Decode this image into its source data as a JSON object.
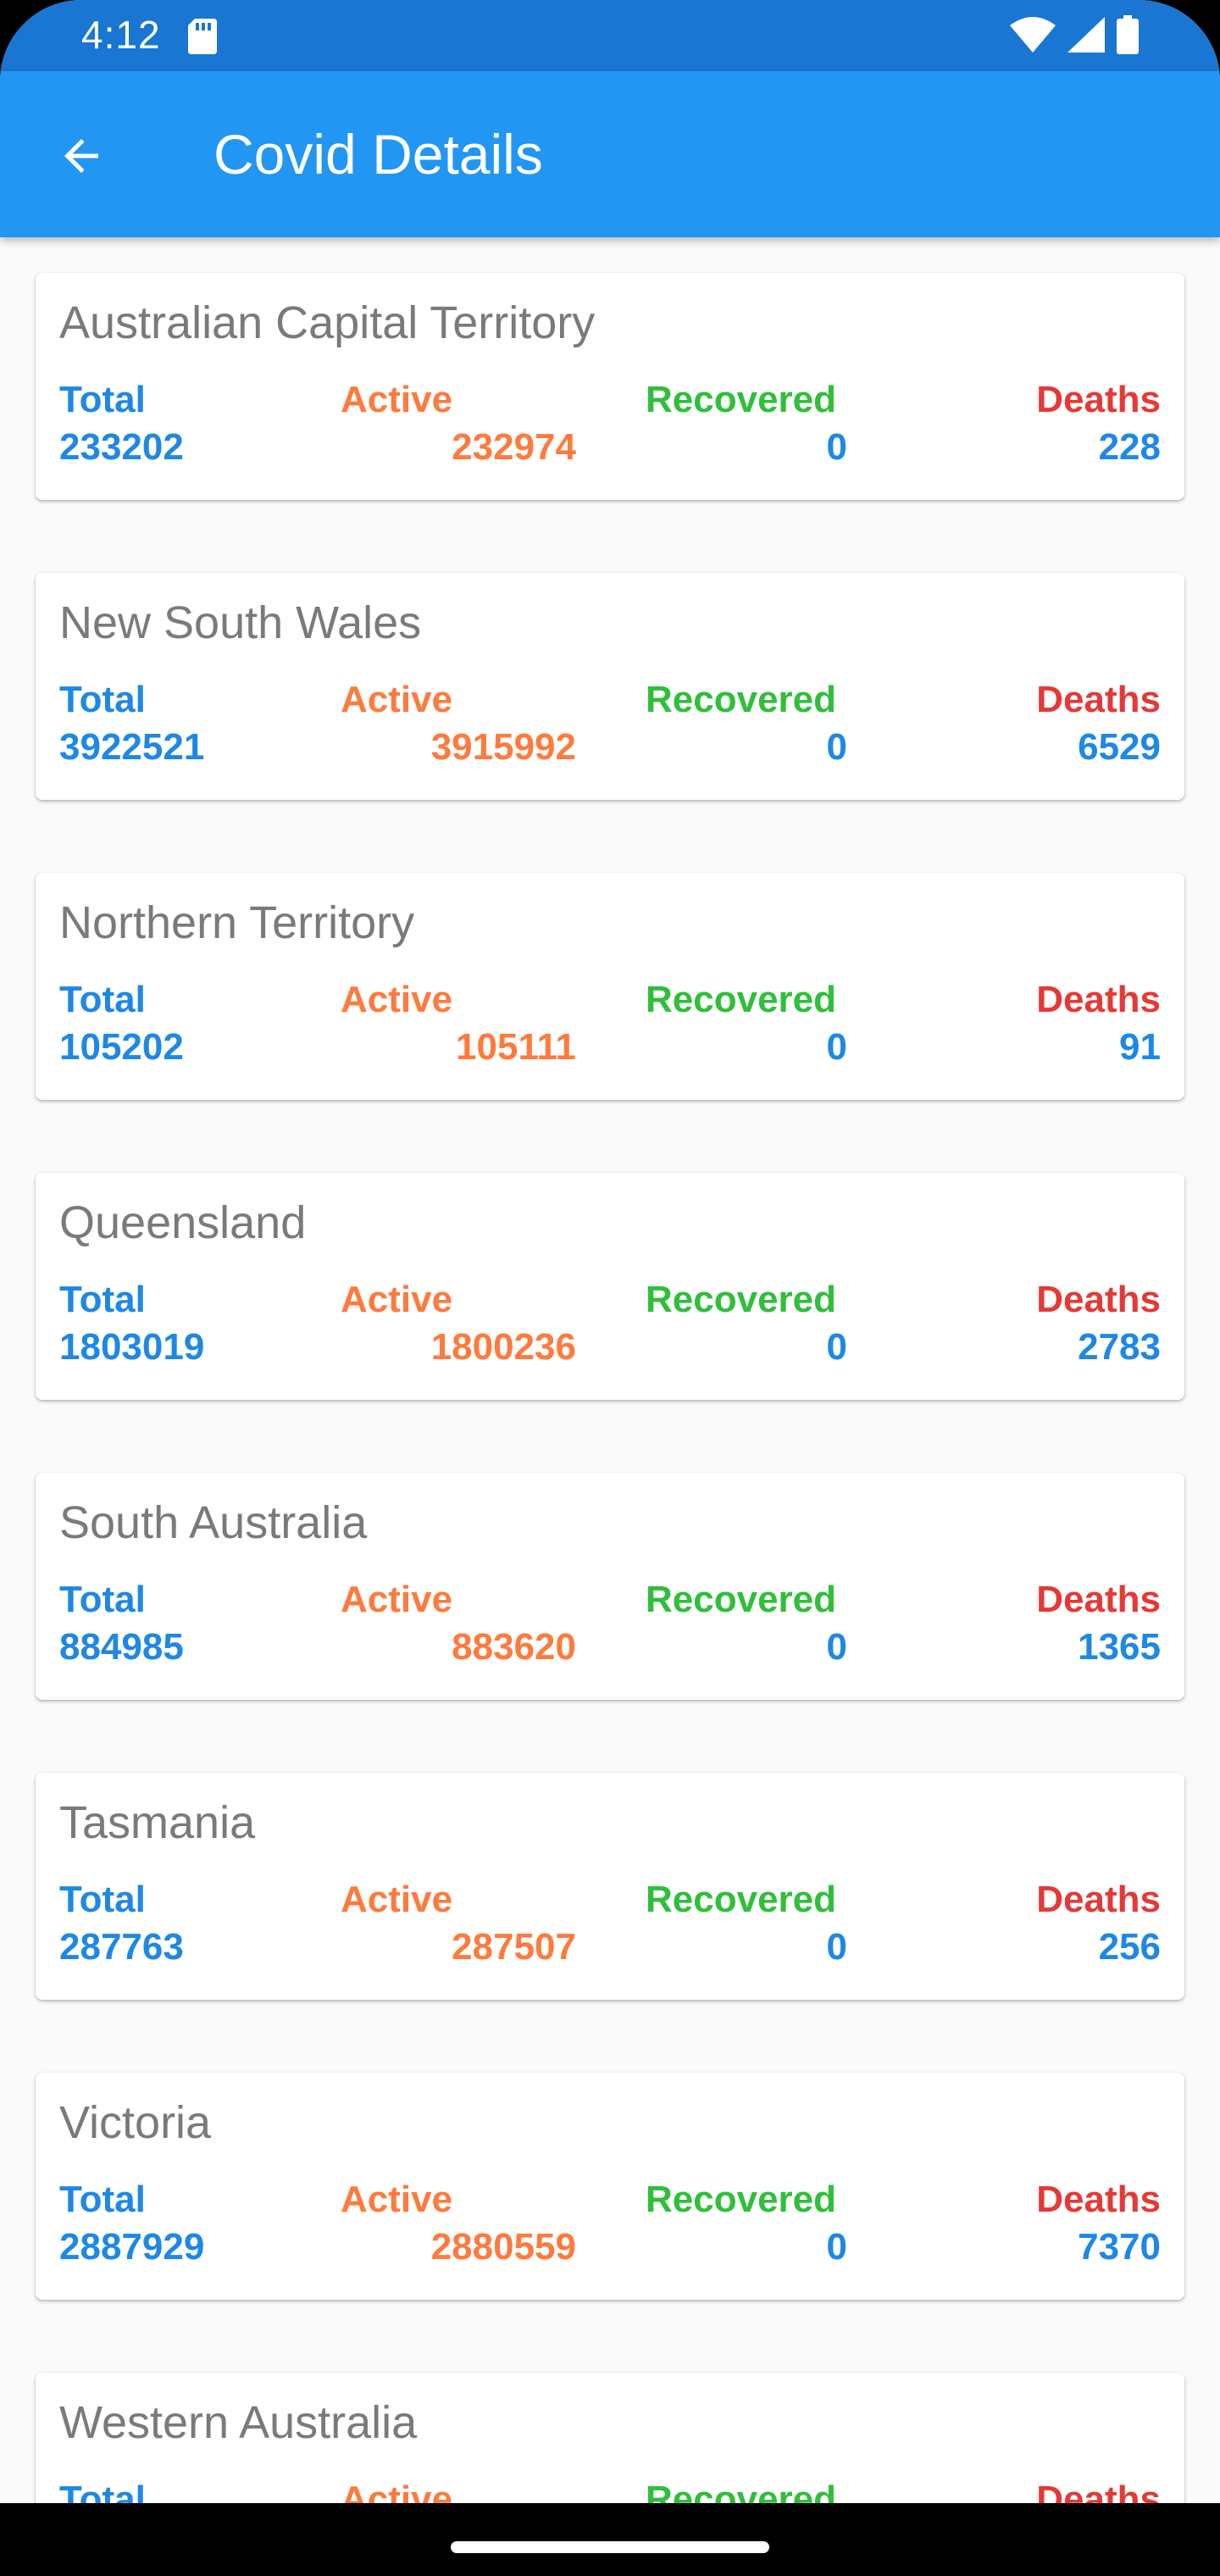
{
  "status_bar": {
    "time": "4:12",
    "icons": [
      "sd-card-icon",
      "wifi-icon",
      "cell-signal-icon",
      "battery-icon"
    ]
  },
  "app_bar": {
    "title": "Covid Details",
    "back_icon": "arrow-left-icon"
  },
  "labels": {
    "total": "Total",
    "active": "Active",
    "recovered": "Recovered",
    "deaths": "Deaths"
  },
  "states": [
    {
      "name": "Australian Capital Territory",
      "total": "233202",
      "active": "232974",
      "recovered": "0",
      "deaths": "228"
    },
    {
      "name": "New South Wales",
      "total": "3922521",
      "active": "3915992",
      "recovered": "0",
      "deaths": "6529"
    },
    {
      "name": "Northern Territory",
      "total": "105202",
      "active": "105111",
      "recovered": "0",
      "deaths": "91"
    },
    {
      "name": "Queensland",
      "total": "1803019",
      "active": "1800236",
      "recovered": "0",
      "deaths": "2783"
    },
    {
      "name": "South Australia",
      "total": "884985",
      "active": "883620",
      "recovered": "0",
      "deaths": "1365"
    },
    {
      "name": "Tasmania",
      "total": "287763",
      "active": "287507",
      "recovered": "0",
      "deaths": "256"
    },
    {
      "name": "Victoria",
      "total": "2887929",
      "active": "2880559",
      "recovered": "0",
      "deaths": "7370"
    },
    {
      "name": "Western Australia",
      "total": "",
      "active": "",
      "recovered": "",
      "deaths": ""
    }
  ],
  "colors": {
    "status_bar": "#1976d2",
    "app_bar": "#2196f3",
    "total": "#1e88e5",
    "active": "#ff7a3d",
    "recovered": "#2fbf3a",
    "deaths": "#e53935"
  }
}
